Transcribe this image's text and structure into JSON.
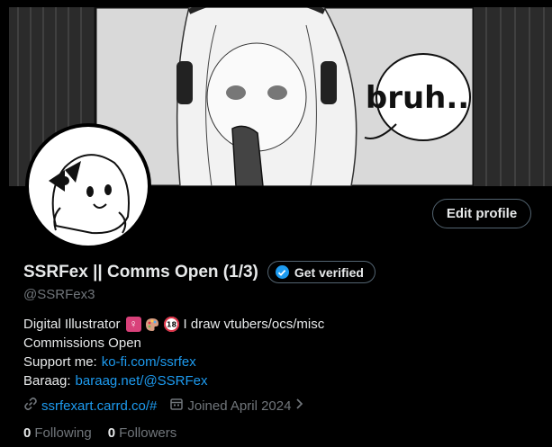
{
  "banner": {
    "caption": "bruh..."
  },
  "profile": {
    "display_name": "SSRFex || Comms Open (1/3)",
    "handle": "@SSRFex3",
    "edit_label": "Edit profile",
    "verify_label": "Get verified"
  },
  "bio": {
    "line1_text": "Digital Illustrator",
    "line1_suffix": "I draw vtubers/ocs/misc",
    "line2": "Commissions Open",
    "support_label": "Support me:",
    "support_link": "ko-fi.com/ssrfex",
    "baraag_label": "Baraag:",
    "baraag_link": "baraag.net/@SSRFex",
    "emoji": [
      "female-sign",
      "artist-palette",
      "no-one-under-eighteen"
    ]
  },
  "meta": {
    "website": "ssrfexart.carrd.co/#",
    "joined": "Joined April 2024"
  },
  "stats": {
    "following_count": "0",
    "following_label": "Following",
    "followers_count": "0",
    "followers_label": "Followers"
  },
  "colors": {
    "background": "#000000",
    "text": "#e7e9ea",
    "muted": "#71767b",
    "accent": "#1d9bf0",
    "border": "#536471"
  }
}
